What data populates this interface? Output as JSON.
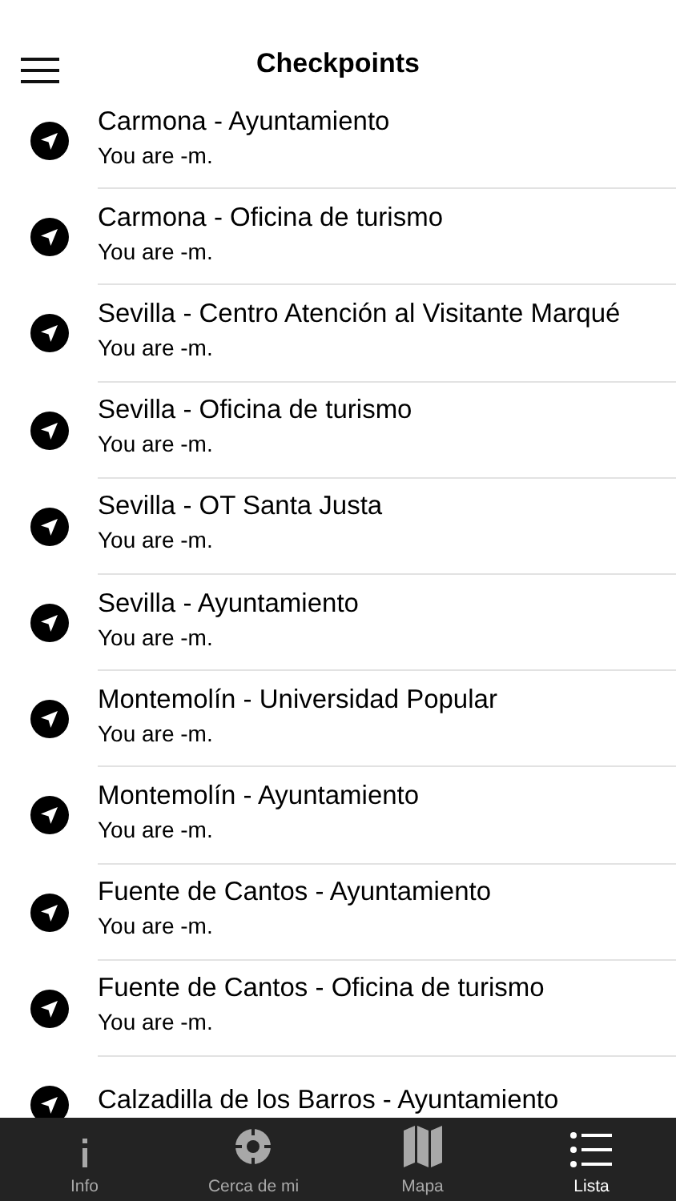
{
  "header": {
    "title": "Checkpoints"
  },
  "checkpoints": [
    {
      "name": "Carmona - Ayuntamiento",
      "distance": "You are -m."
    },
    {
      "name": "Carmona - Oficina de turismo",
      "distance": "You are -m."
    },
    {
      "name": "Sevilla - Centro Atención al Visitante Marqué",
      "distance": "You are -m."
    },
    {
      "name": "Sevilla - Oficina de turismo",
      "distance": "You are -m."
    },
    {
      "name": "Sevilla - OT Santa Justa",
      "distance": "You are -m."
    },
    {
      "name": "Sevilla - Ayuntamiento",
      "distance": "You are -m."
    },
    {
      "name": "Montemolín - Universidad Popular",
      "distance": "You are -m."
    },
    {
      "name": "Montemolín - Ayuntamiento",
      "distance": "You are -m."
    },
    {
      "name": "Fuente de Cantos - Ayuntamiento",
      "distance": "You are -m."
    },
    {
      "name": "Fuente de Cantos - Oficina de turismo",
      "distance": "You are -m."
    },
    {
      "name": "Calzadilla de los Barros - Ayuntamiento"
    }
  ],
  "tabs": [
    {
      "kind": "info",
      "label": "Info",
      "selected": false
    },
    {
      "kind": "near",
      "label": "Cerca de mi",
      "selected": false
    },
    {
      "kind": "map",
      "label": "Mapa",
      "selected": false
    },
    {
      "kind": "list",
      "label": "Lista",
      "selected": true
    }
  ]
}
